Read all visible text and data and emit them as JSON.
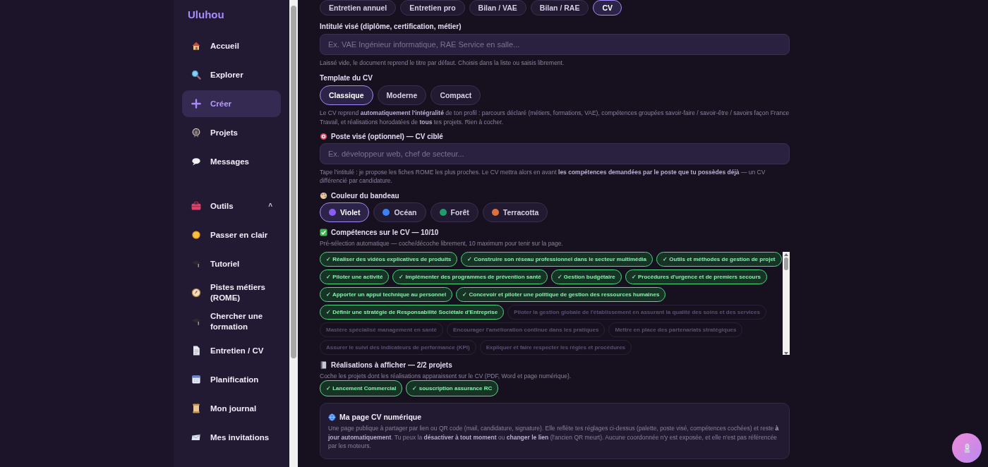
{
  "sidebar": {
    "brand": "Uluhou",
    "items": [
      {
        "label": "Accueil",
        "selected": false
      },
      {
        "label": "Explorer",
        "selected": false
      },
      {
        "label": "Créer",
        "selected": true
      },
      {
        "label": "Projets",
        "selected": false
      },
      {
        "label": "Messages",
        "selected": false
      }
    ],
    "tools": {
      "label": "Outils",
      "caret": "^",
      "expanded": true,
      "children": [
        {
          "label": "Passer en clair",
          "selected": false
        },
        {
          "label": "Tutoriel",
          "selected": false
        },
        {
          "label": "Pistes métiers (ROME)",
          "selected": false
        },
        {
          "label": "Chercher une formation",
          "selected": false
        },
        {
          "label": "Entretien / CV",
          "selected": false
        },
        {
          "label": "Planification",
          "selected": false
        },
        {
          "label": "Mon journal",
          "selected": false
        },
        {
          "label": "Mes invitations",
          "selected": false
        }
      ]
    }
  },
  "doc_tabs": [
    {
      "label": "Entretien annuel",
      "selected": false
    },
    {
      "label": "Entretien pro",
      "selected": false
    },
    {
      "label": "Bilan / VAE",
      "selected": false
    },
    {
      "label": "Bilan / RAE",
      "selected": false
    },
    {
      "label": "CV",
      "selected": true
    }
  ],
  "title_field": {
    "label": "Intitulé visé (diplôme, certification, métier)",
    "placeholder": "Ex. VAE Ingénieur informatique, RAE Service en salle...",
    "hint": "Laissé vide, le document reprend le titre par défaut. Choisis dans la liste ou saisis librement."
  },
  "template": {
    "label": "Template du CV",
    "options": [
      {
        "label": "Classique",
        "selected": true
      },
      {
        "label": "Moderne",
        "selected": false
      },
      {
        "label": "Compact",
        "selected": false
      }
    ],
    "note": "Le CV reprend **automatiquement l'intégralité** de ton profil : parcours déclaré (métiers, formations, VAE), compétences groupées savoir-faire / savoir-être / savoirs façon France Travail, et réalisations horodatées de **tous** tes projets. Rien à cocher."
  },
  "target_job": {
    "label": "Poste visé (optionnel) — CV ciblé",
    "placeholder": "Ex. développeur web, chef de secteur...",
    "hint": "Tape l'intitulé : je propose les fiches ROME les plus proches. Le CV mettra alors en avant **les compétences demandées par le poste que tu possèdes déjà** — un CV différencié par candidature."
  },
  "banner_color": {
    "label": "Couleur du bandeau",
    "options": [
      {
        "label": "Violet",
        "color": "#8b5cf6",
        "selected": true
      },
      {
        "label": "Océan",
        "color": "#3b82f6",
        "selected": false
      },
      {
        "label": "Forêt",
        "color": "#1f9d6b",
        "selected": false
      },
      {
        "label": "Terracotta",
        "color": "#e0703a",
        "selected": false
      }
    ]
  },
  "skills": {
    "label": "Compétences sur le CV — 10/10",
    "hint": "Pré-sélection automatique — coche/décoche librement, 10 maximum pour tenir sur la page.",
    "items": [
      {
        "label": "✓ Réaliser des vidéos explicatives de produits",
        "checked": true
      },
      {
        "label": "✓ Construire son réseau professionnel dans le secteur multimédia",
        "checked": true
      },
      {
        "label": "✓ Outils et méthodes de gestion de projet",
        "checked": true
      },
      {
        "label": "✓ Piloter une activité",
        "checked": true
      },
      {
        "label": "✓ Implémenter des programmes de prévention santé",
        "checked": true
      },
      {
        "label": "✓ Gestion budgétaire",
        "checked": true
      },
      {
        "label": "✓ Procédures d'urgence et de premiers secours",
        "checked": true
      },
      {
        "label": "✓ Apporter un appui technique au personnel",
        "checked": true
      },
      {
        "label": "✓ Concevoir et piloter une politique de gestion des ressources humaines",
        "checked": true
      },
      {
        "label": "✓ Définir une stratégie de Responsabilité Sociétale d'Entreprise",
        "checked": true
      },
      {
        "label": "Piloter la gestion globale de l'établissement en assurant la qualité des soins et des services",
        "checked": false
      },
      {
        "label": "Mastère spécialisé management en santé",
        "checked": false
      },
      {
        "label": "Encourager l'amélioration continue dans les pratiques",
        "checked": false
      },
      {
        "label": "Mettre en place des partenariats stratégiques",
        "checked": false
      },
      {
        "label": "Assurer le suivi des indicateurs de performance (KPI)",
        "checked": false
      },
      {
        "label": "Expliquer et faire respecter les règles et procédures",
        "checked": false
      }
    ]
  },
  "achievements": {
    "label": "Réalisations à afficher — 2/2 projets",
    "hint": "Coche les projets dont les réalisations apparaissent sur le CV (PDF, Word et page numérique).",
    "items": [
      {
        "label": "✓ Lancement Commercial",
        "checked": true
      },
      {
        "label": "✓ souscription assurance RC",
        "checked": true
      }
    ]
  },
  "digital_page": {
    "title": "Ma page CV numérique",
    "text": "Une page publique à partager par lien ou QR code (mail, candidature, signature). Elle reflète tes réglages ci-dessus (palette, poste visé, compétences cochées) et reste **à jour automatiquement**. Tu peux la **désactiver à tout moment** ou **changer le lien** (l'ancien QR meurt). Aucune coordonnée n'y est exposée, et elle n'est pas référencée par les moteurs."
  }
}
